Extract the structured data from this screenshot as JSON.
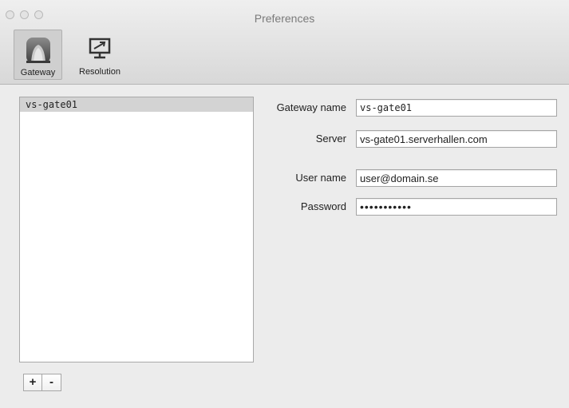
{
  "window": {
    "title": "Preferences"
  },
  "toolbar": {
    "items": [
      {
        "label": "Gateway",
        "icon": "gateway-icon",
        "selected": true
      },
      {
        "label": "Resolution",
        "icon": "resolution-icon",
        "selected": false
      }
    ]
  },
  "gateways": {
    "items": [
      "vs-gate01"
    ],
    "selected_index": 0
  },
  "form": {
    "gateway_name": {
      "label": "Gateway name",
      "value": "vs-gate01"
    },
    "server": {
      "label": "Server",
      "value": "vs-gate01.serverhallen.com"
    },
    "user_name": {
      "label": "User name",
      "value": "user@domain.se"
    },
    "password": {
      "label": "Password",
      "value": "•••••••••••"
    }
  },
  "list_buttons": {
    "add_label": "+",
    "remove_label": "-"
  }
}
